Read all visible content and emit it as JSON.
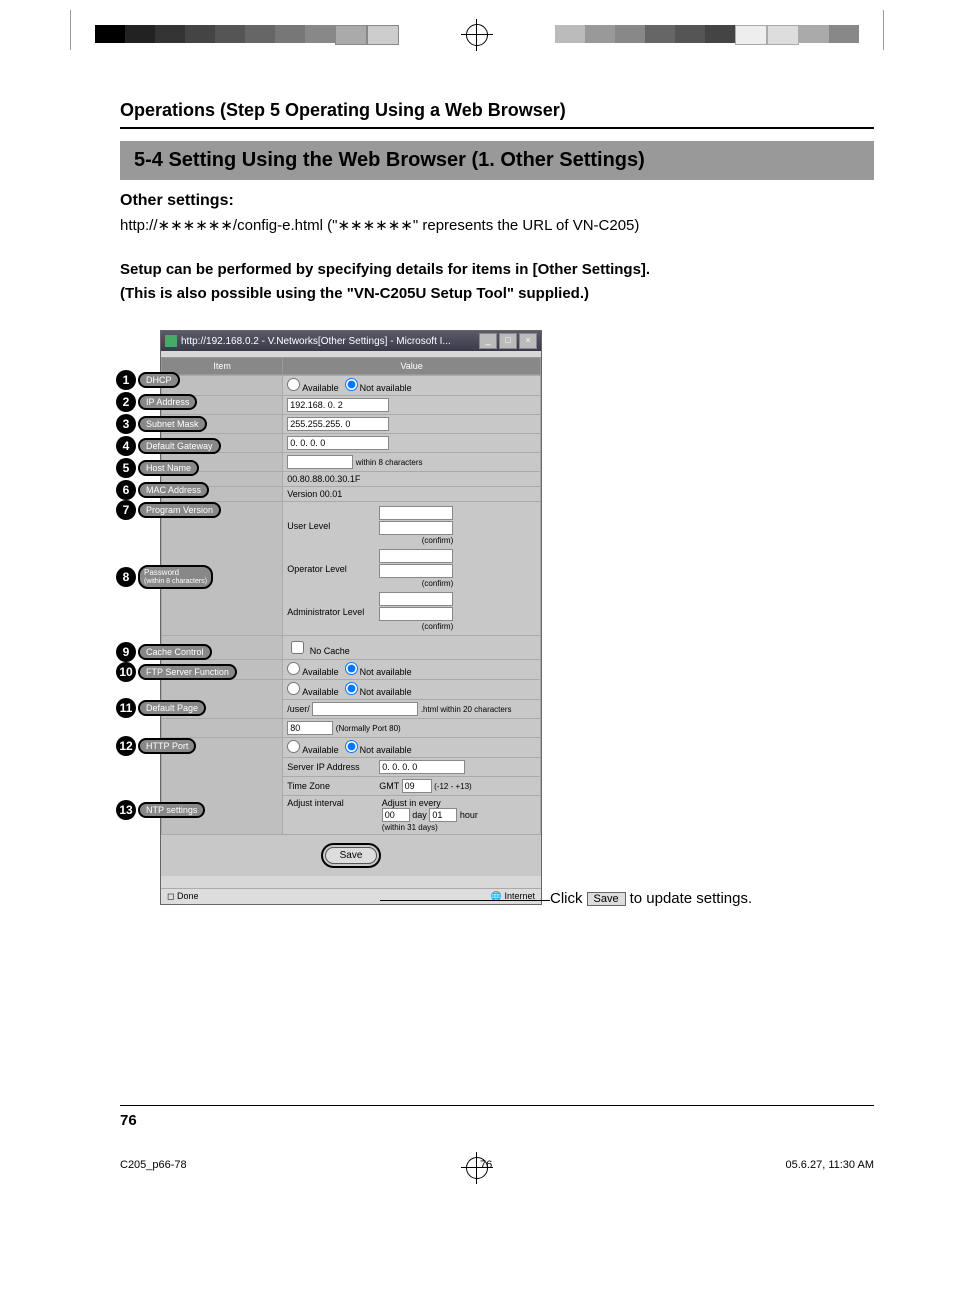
{
  "header": "Operations (Step 5 Operating Using a Web Browser)",
  "section_title": "5-4 Setting Using the Web Browser (1. Other Settings)",
  "subheading": "Other settings:",
  "url_line": "http://∗∗∗∗∗∗/config-e.html (\"∗∗∗∗∗∗\" represents the URL of VN-C205)",
  "setup_text_1": "Setup can be performed by specifying details for items in [Other Settings].",
  "setup_text_2": "(This is also possible using the \"VN-C205U Setup Tool\" supplied.)",
  "browser": {
    "title": "http://192.168.0.2 - V.Networks[Other Settings] - Microsoft I...",
    "th_item": "Item",
    "th_value": "Value",
    "status_done": "Done",
    "status_zone": "Internet"
  },
  "rows": {
    "dhcp": {
      "label": "DHCP",
      "opt_available": "Available",
      "opt_not": "Not available"
    },
    "ip": {
      "label": "IP Address",
      "value": "192.168. 0. 2"
    },
    "subnet": {
      "label": "Subnet Mask",
      "value": "255.255.255. 0"
    },
    "gateway": {
      "label": "Default Gateway",
      "value": "0. 0. 0. 0"
    },
    "host": {
      "label": "Host Name",
      "value": "",
      "hint": "within 8 characters"
    },
    "mac": {
      "label": "MAC Address",
      "value": "00.80.88.00.30.1F"
    },
    "version": {
      "label": "Program Version",
      "value": "Version 00.01"
    },
    "password": {
      "label": "Password",
      "sublabel": "(within 8 characters)",
      "user": "User Level",
      "operator": "Operator Level",
      "admin": "Administrator Level",
      "confirm": "(confirm)"
    },
    "cache": {
      "label": "Cache Control",
      "option": "No Cache"
    },
    "ftp": {
      "label": "FTP Server Function",
      "opt_available": "Available",
      "opt_not": "Not available"
    },
    "default_page": {
      "label": "Default Page",
      "opt_available": "Available",
      "opt_not": "Not available",
      "prefix": "/user/",
      "value": "",
      "suffix": ".html within 20 characters"
    },
    "http": {
      "label": "HTTP Port",
      "value": "80",
      "hint": "(Normally Port 80)"
    },
    "ntp": {
      "label": "NTP settings",
      "opt_available": "Available",
      "opt_not": "Not available",
      "server_label": "Server IP Address",
      "server_value": "0. 0. 0. 0",
      "tz_label": "Time Zone",
      "tz_prefix": "GMT",
      "tz_value": "09",
      "tz_range": "(-12 - +13)",
      "adjust_label": "Adjust interval",
      "adjust_prefix": "Adjust in every",
      "adjust_day": "00",
      "adjust_day_label": "day",
      "adjust_hour": "01",
      "adjust_hour_label": "hour",
      "adjust_hint": "(within 31 days)"
    },
    "save": "Save"
  },
  "callouts": [
    {
      "n": "1",
      "tag": "DHCP"
    },
    {
      "n": "2",
      "tag": "IP Address"
    },
    {
      "n": "3",
      "tag": "Subnet Mask"
    },
    {
      "n": "4",
      "tag": "Default Gateway"
    },
    {
      "n": "5",
      "tag": "Host Name"
    },
    {
      "n": "6",
      "tag": "MAC Address"
    },
    {
      "n": "7",
      "tag": "Program Version"
    },
    {
      "n": "8",
      "tag": "Password\n(within 8 characters)"
    },
    {
      "n": "9",
      "tag": "Cache Control"
    },
    {
      "n": "10",
      "tag": "FTP Server Function"
    },
    {
      "n": "11",
      "tag": "Default Page"
    },
    {
      "n": "12",
      "tag": "HTTP Port"
    },
    {
      "n": "13",
      "tag": "NTP settings"
    }
  ],
  "click_note": {
    "pre": "Click",
    "btn": "Save",
    "post": "to update settings."
  },
  "page_number": "76",
  "print_footer": {
    "file": "C205_p66-78",
    "page": "76",
    "date": "05.6.27, 11:30 AM"
  }
}
